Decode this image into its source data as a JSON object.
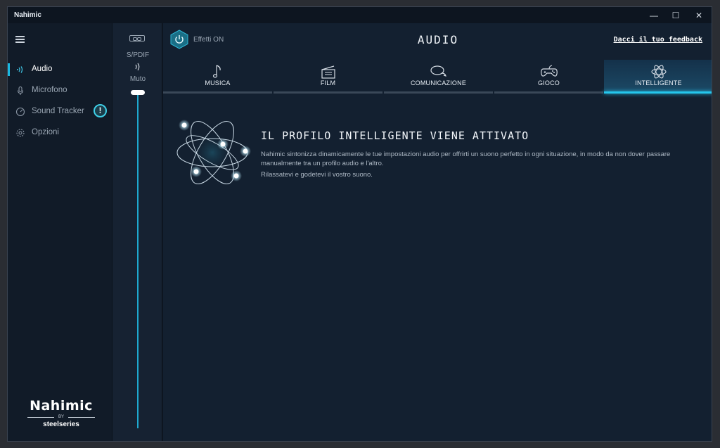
{
  "window": {
    "title": "Nahimic"
  },
  "window_controls": {
    "minimize": "—",
    "maximize": "☐",
    "close": "✕"
  },
  "sidebar": {
    "items": [
      {
        "label": "Audio",
        "icon": "speaker-waves-icon",
        "active": true
      },
      {
        "label": "Microfono",
        "icon": "microphone-icon",
        "active": false
      },
      {
        "label": "Sound Tracker",
        "icon": "radar-icon",
        "active": false
      },
      {
        "label": "Opzioni",
        "icon": "gear-icon",
        "active": false
      }
    ],
    "sound_tracker_badge": "!",
    "brand": {
      "logo": "Nahimic",
      "by": "BY",
      "partner": "steelseries"
    }
  },
  "device": {
    "label": "S/PDIF",
    "mute_label": "Muto",
    "volume": 1.0
  },
  "header": {
    "effects_label": "Effetti ON",
    "title": "AUDIO",
    "feedback": "Dacci il tuo feedback"
  },
  "tabs": [
    {
      "label": "MUSICA",
      "icon": "music-note-icon"
    },
    {
      "label": "FILM",
      "icon": "clapperboard-icon"
    },
    {
      "label": "COMUNICAZIONE",
      "icon": "chat-bubbles-icon"
    },
    {
      "label": "GIOCO",
      "icon": "gamepad-icon"
    },
    {
      "label": "INTELLIGENTE",
      "icon": "atom-icon",
      "active": true
    }
  ],
  "smart": {
    "title": "IL PROFILO INTELLIGENTE VIENE ATTIVATO",
    "description": "Nahimic sintonizza dinamicamente le tue impostazioni audio per offrirti un suono perfetto in ogni situazione, in modo da non dover passare manualmente tra un profilo audio e l'altro.",
    "note": "Rilassatevi e godetevi il vostro suono."
  },
  "colors": {
    "accent": "#25c6ec",
    "background": "#132030",
    "sidebar": "#111b28"
  }
}
